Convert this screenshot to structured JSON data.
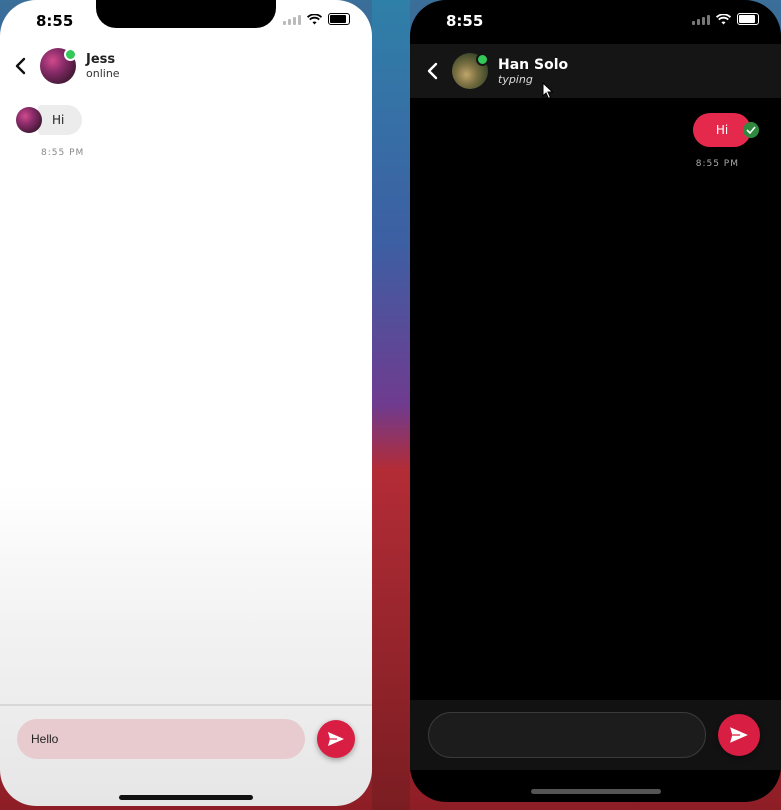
{
  "left_phone": {
    "status_time": "8:55",
    "contact": {
      "name": "Jess",
      "status": "online"
    },
    "messages": [
      {
        "direction": "incoming",
        "text": "Hi",
        "time": "8:55 PM"
      }
    ],
    "composer": {
      "value": "Hello",
      "placeholder": ""
    }
  },
  "right_phone": {
    "status_time": "8:55",
    "contact": {
      "name": "Han Solo",
      "status": "typing"
    },
    "messages": [
      {
        "direction": "outgoing",
        "text": "Hi",
        "time": "8:55 PM",
        "read": true
      }
    ],
    "composer": {
      "value": "",
      "placeholder": ""
    }
  },
  "colors": {
    "accent": "#d81f43",
    "online": "#34c759",
    "read_check": "#2f8a3f"
  },
  "icons": [
    "chevron-left-icon",
    "send-icon",
    "check-icon",
    "wifi-icon",
    "battery-icon",
    "cursor-icon"
  ]
}
